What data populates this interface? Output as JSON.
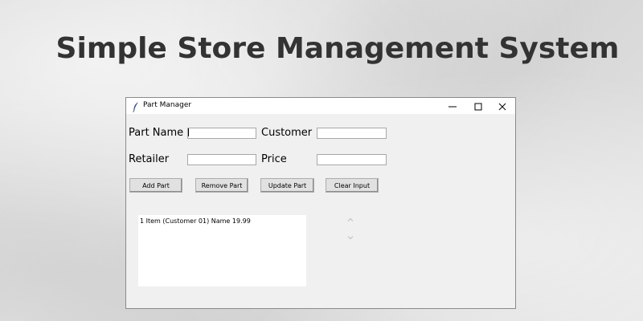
{
  "headline": "Simple Store Management System",
  "window": {
    "title": "Part Manager",
    "icon": "feather-icon",
    "controls": [
      "minimize-icon",
      "maximize-icon",
      "close-icon"
    ]
  },
  "form": {
    "part_name_label": "Part Name",
    "customer_label": "Customer",
    "retailer_label": "Retailer",
    "price_label": "Price",
    "part_name_value": "",
    "customer_value": "",
    "retailer_value": "",
    "price_value": ""
  },
  "buttons": {
    "add": "Add Part",
    "remove": "Remove Part",
    "update": "Update Part",
    "clear": "Clear Input"
  },
  "parts_list": {
    "items": [
      "1 Item (Customer 01) Name 19.99"
    ]
  },
  "colors": {
    "window_bg": "#f0f0f0",
    "titlebar_bg": "#ffffff",
    "button_bg": "#e1e1e1",
    "headline": "#333333"
  }
}
